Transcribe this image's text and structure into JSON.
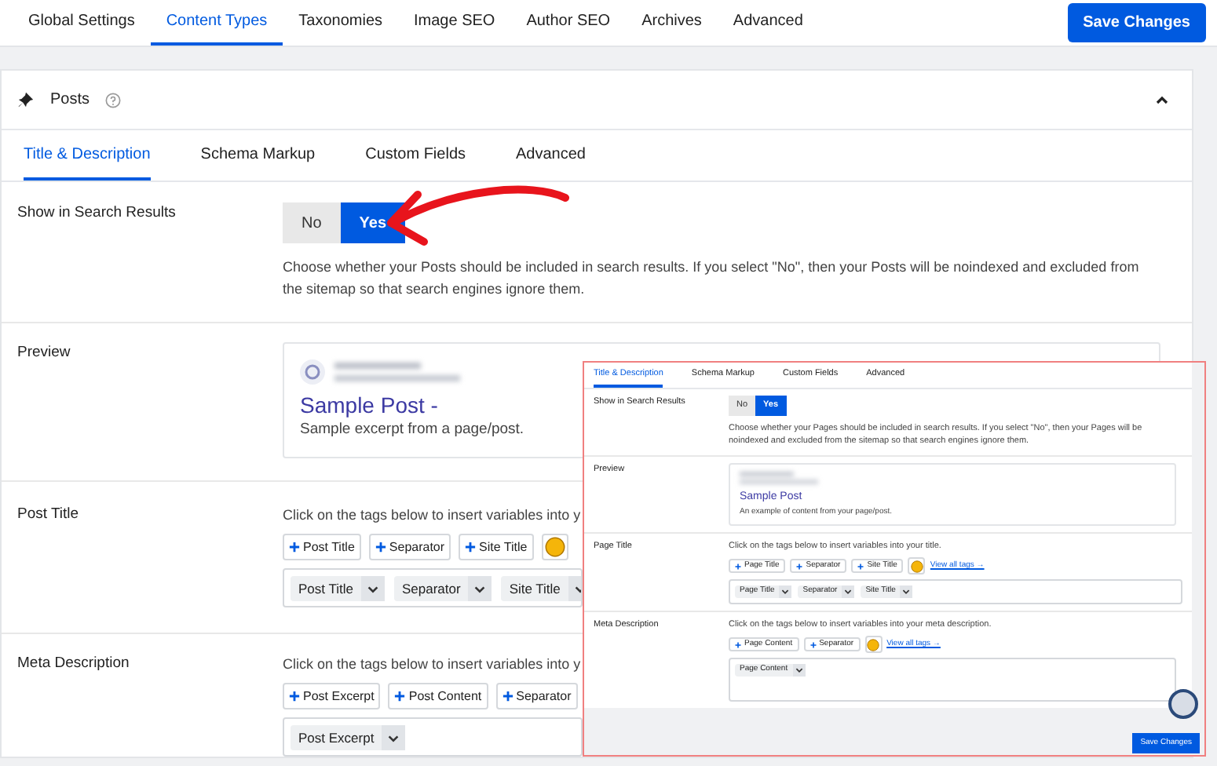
{
  "top_tabs": [
    {
      "label": "Global Settings",
      "selected": false
    },
    {
      "label": "Content Types",
      "selected": true
    },
    {
      "label": "Taxonomies",
      "selected": false
    },
    {
      "label": "Image SEO",
      "selected": false
    },
    {
      "label": "Author SEO",
      "selected": false
    },
    {
      "label": "Archives",
      "selected": false
    },
    {
      "label": "Advanced",
      "selected": false
    }
  ],
  "save_button": "Save Changes",
  "panel": {
    "title": "Posts",
    "expanded": true,
    "tabs": [
      {
        "label": "Title & Description",
        "selected": true
      },
      {
        "label": "Schema Markup",
        "selected": false
      },
      {
        "label": "Custom Fields",
        "selected": false
      },
      {
        "label": "Advanced",
        "selected": false
      }
    ],
    "search_visibility": {
      "label": "Show in Search Results",
      "options": [
        {
          "label": "No",
          "selected": false
        },
        {
          "label": "Yes",
          "selected": true
        }
      ],
      "help": "Choose whether your Posts should be included in search results. If you select \"No\", then your Posts will be noindexed and excluded from the sitemap so that search engines ignore them."
    },
    "preview": {
      "label": "Preview",
      "title": "Sample Post -",
      "excerpt": "Sample excerpt from a page/post."
    },
    "title_field": {
      "label": "Post Title",
      "help": "Click on the tags below to insert variables into y",
      "tags": [
        "Post Title",
        "Separator",
        "Site Title"
      ],
      "tokens": [
        "Post Title",
        "Separator",
        "Site Title"
      ]
    },
    "description_field": {
      "label": "Meta Description",
      "help": "Click on the tags below to insert variables into y",
      "tags": [
        "Post Excerpt",
        "Post Content",
        "Separator"
      ],
      "tokens": [
        "Post Excerpt"
      ]
    }
  },
  "inset": {
    "tabs": [
      {
        "label": "Title & Description",
        "selected": true
      },
      {
        "label": "Schema Markup",
        "selected": false
      },
      {
        "label": "Custom Fields",
        "selected": false
      },
      {
        "label": "Advanced",
        "selected": false
      }
    ],
    "search_visibility": {
      "label": "Show in Search Results",
      "options": [
        {
          "label": "No",
          "selected": false
        },
        {
          "label": "Yes",
          "selected": true
        }
      ],
      "help": "Choose whether your Pages should be included in search results. If you select \"No\", then your Pages will be noindexed and excluded from the sitemap so that search engines ignore them."
    },
    "preview": {
      "label": "Preview",
      "title": "Sample Post",
      "excerpt": "An example of content from your page/post."
    },
    "title_field": {
      "label": "Page Title",
      "help": "Click on the tags below to insert variables into your title.",
      "tags": [
        "Page Title",
        "Separator",
        "Site Title"
      ],
      "link": "View all tags →",
      "tokens": [
        "Page Title",
        "Separator",
        "Site Title"
      ]
    },
    "description_field": {
      "label": "Meta Description",
      "help": "Click on the tags below to insert variables into your meta description.",
      "tags": [
        "Page Content",
        "Separator"
      ],
      "link": "View all tags →",
      "tokens": [
        "Page Content"
      ]
    },
    "save_button": "Save Changes"
  }
}
